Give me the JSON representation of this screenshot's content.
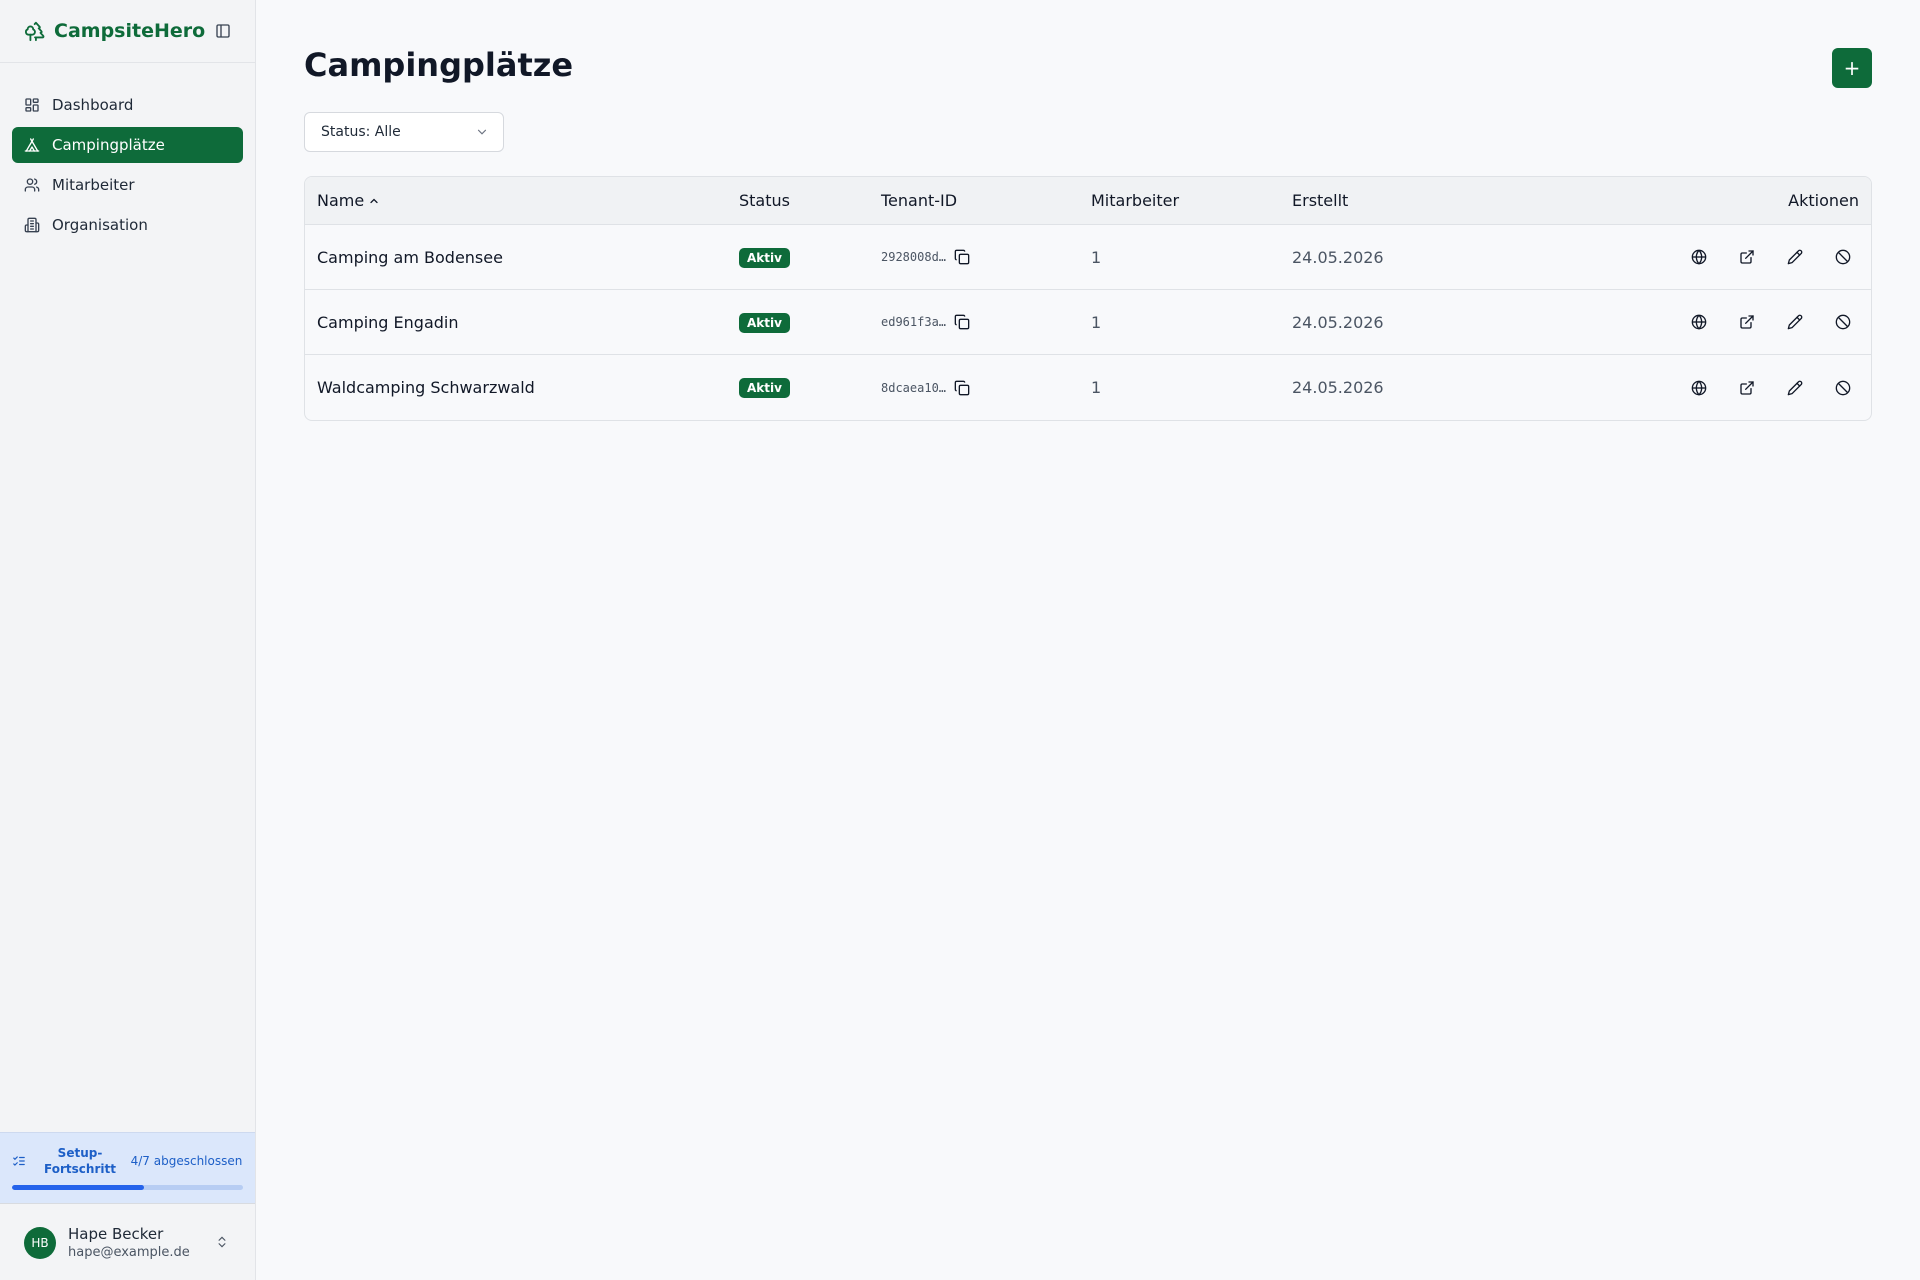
{
  "app": {
    "name": "CampsiteHero"
  },
  "sidebar": {
    "items": [
      {
        "label": "Dashboard",
        "icon": "dashboard-icon",
        "active": false
      },
      {
        "label": "Campingplätze",
        "icon": "tent-icon",
        "active": true
      },
      {
        "label": "Mitarbeiter",
        "icon": "users-icon",
        "active": false
      },
      {
        "label": "Organisation",
        "icon": "building-icon",
        "active": false
      }
    ],
    "setup": {
      "title": "Setup-Fortschritt",
      "count": "4/7 abgeschlossen",
      "progress": 0.57
    },
    "user": {
      "initials": "HB",
      "name": "Hape Becker",
      "email": "hape@example.de"
    }
  },
  "main": {
    "title": "Campingplätze",
    "add_button": "+",
    "filter": {
      "label": "Status: Alle"
    },
    "table": {
      "columns": {
        "name": "Name",
        "status": "Status",
        "tenant": "Tenant-ID",
        "staff": "Mitarbeiter",
        "created": "Erstellt",
        "actions": "Aktionen"
      },
      "rows": [
        {
          "name": "Camping am Bodensee",
          "status": "Aktiv",
          "tenant": "2928008d…",
          "staff": "1",
          "created": "24.05.2026"
        },
        {
          "name": "Camping Engadin",
          "status": "Aktiv",
          "tenant": "ed961f3a…",
          "staff": "1",
          "created": "24.05.2026"
        },
        {
          "name": "Waldcamping Schwarzwald",
          "status": "Aktiv",
          "tenant": "8dcaea10…",
          "staff": "1",
          "created": "24.05.2026"
        }
      ]
    }
  },
  "colors": {
    "brand": "#0e6b3a",
    "progress": "#2563eb",
    "setup_bg": "#dbe7fb"
  }
}
